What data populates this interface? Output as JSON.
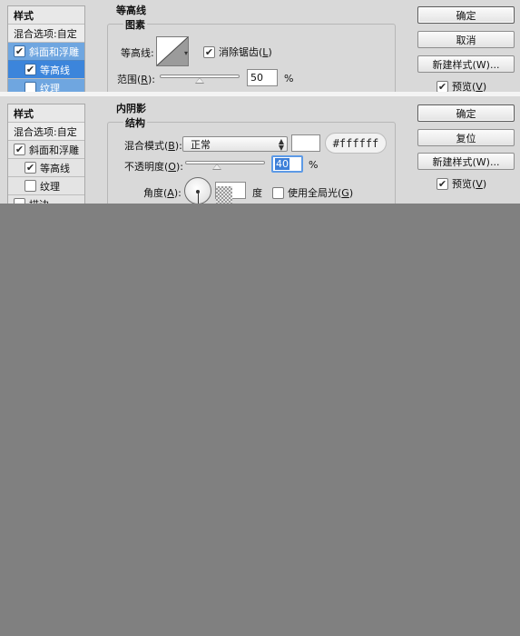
{
  "top": {
    "style_list": {
      "header": "样式",
      "blend_options": "混合选项:自定",
      "bevel_emboss": "斜面和浮雕",
      "contour": "等高线",
      "texture": "纹理"
    },
    "section_title": "等高线",
    "group_title": "图素",
    "contour_label": "等高线:",
    "antialias_label": "消除锯齿(",
    "antialias_key": "L",
    "antialias_close": ")",
    "range_label": "范围(",
    "range_key": "R",
    "range_close": "):",
    "range_value": "50",
    "range_unit": "%",
    "range_percent": 50,
    "buttons": {
      "ok": "确定",
      "cancel": "取消",
      "new_style": "新建样式(W)...",
      "preview": "预览(",
      "preview_key": "V",
      "preview_close": ")"
    }
  },
  "bottom": {
    "style_list": {
      "header": "样式",
      "blend_options": "混合选项:自定",
      "bevel_emboss": "斜面和浮雕",
      "contour": "等高线",
      "texture": "纹理",
      "stroke": "描边"
    },
    "section_title": "内阴影",
    "group_title": "结构",
    "blend_mode_label": "混合模式(",
    "blend_mode_key": "B",
    "blend_mode_close": "):",
    "blend_mode_value": "正常",
    "hex_color": "#ffffff",
    "shadow_color": "#ffffff",
    "opacity_label": "不透明度(",
    "opacity_key": "O",
    "opacity_close": "):",
    "opacity_value": "40",
    "opacity_unit": "%",
    "opacity_percent": 40,
    "angle_label": "角度(",
    "angle_key": "A",
    "angle_close": "):",
    "angle_unit": "度",
    "global_light_label": "使用全局光(",
    "global_light_key": "G",
    "global_light_close": ")",
    "buttons": {
      "ok": "确定",
      "reset": "复位",
      "new_style": "新建样式(W)...",
      "preview": "预览(",
      "preview_key": "V",
      "preview_close": ")"
    }
  },
  "colors": {
    "panel": "#d9d9d9",
    "selected": "#6fa6e0",
    "selected_dark": "#3c85db",
    "background": "#808080"
  }
}
